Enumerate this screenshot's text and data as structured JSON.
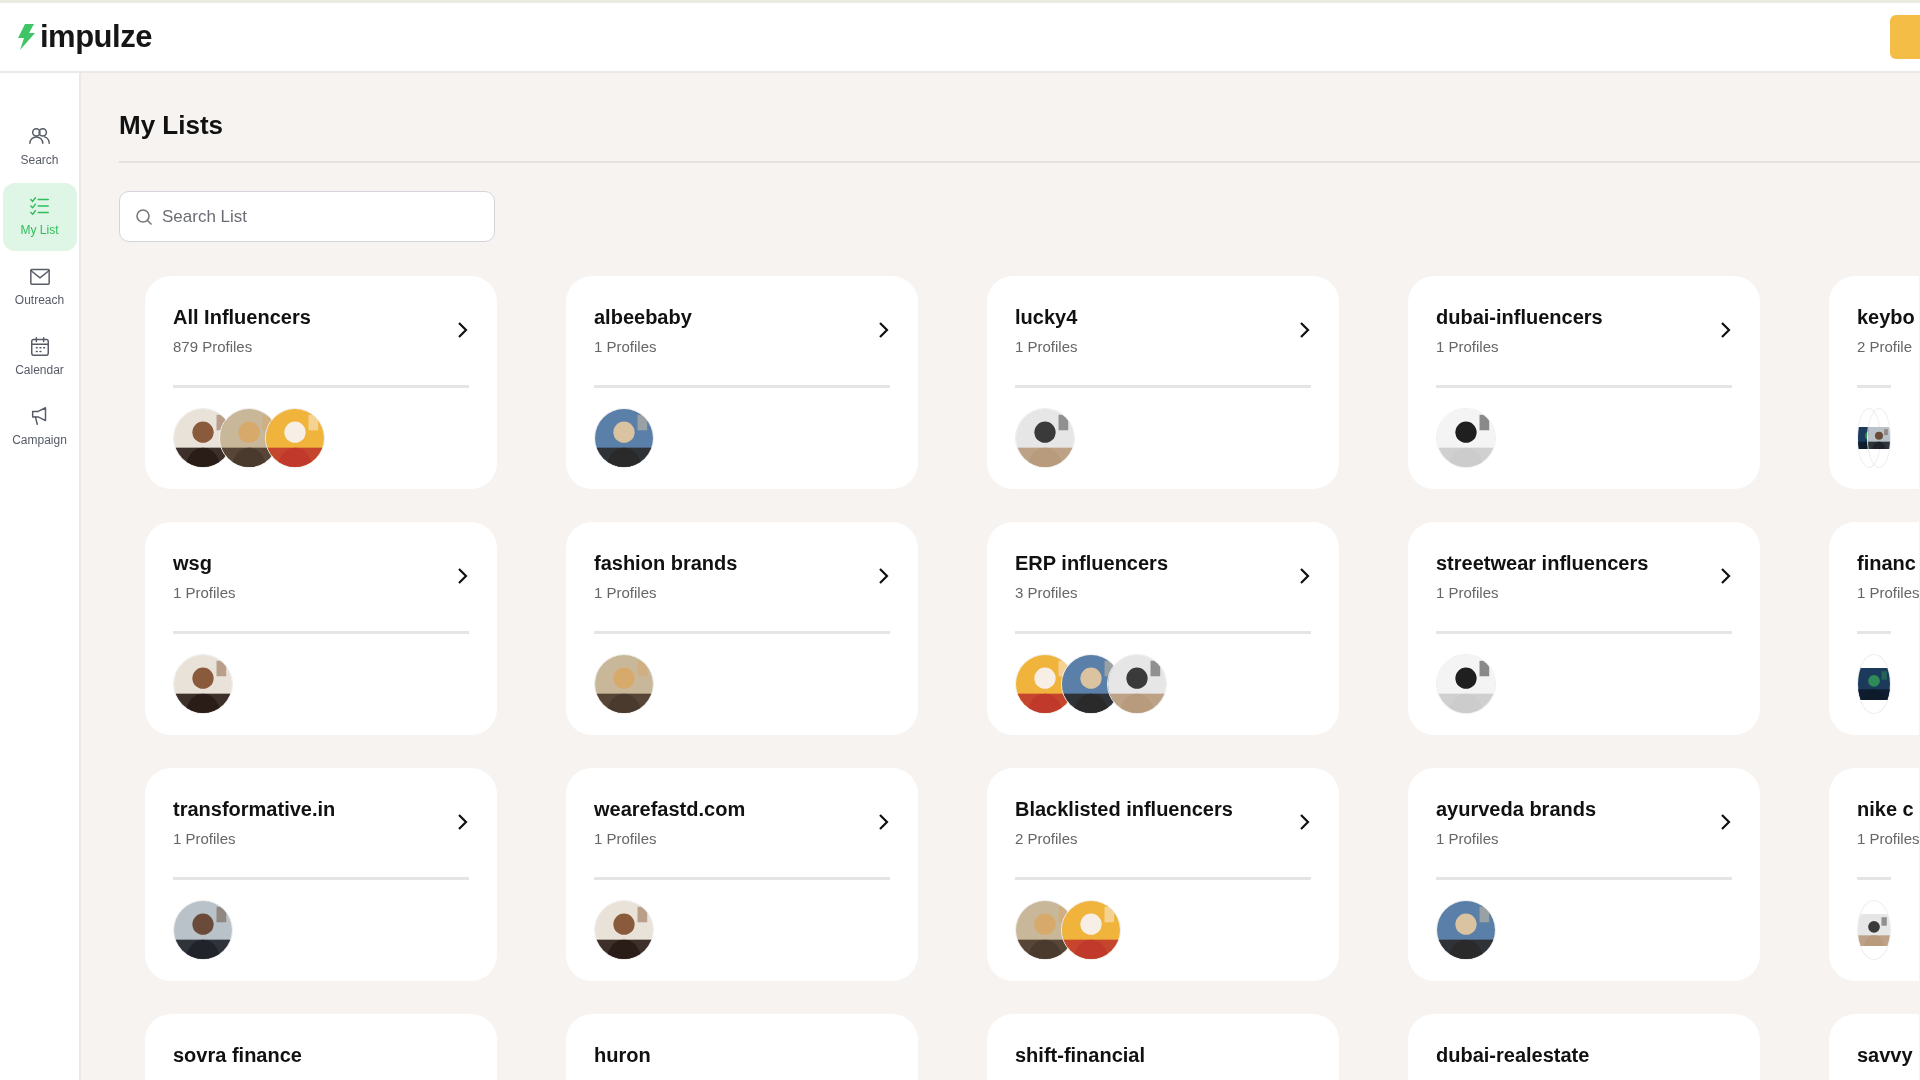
{
  "header": {
    "logo": "impulze"
  },
  "sidebar": {
    "items": [
      {
        "label": "Search",
        "selected": false
      },
      {
        "label": "My List",
        "selected": true
      },
      {
        "label": "Outreach",
        "selected": false
      },
      {
        "label": "Calendar",
        "selected": false
      },
      {
        "label": "Campaign",
        "selected": false
      }
    ]
  },
  "page": {
    "title": "My Lists",
    "search": {
      "placeholder": "Search List"
    }
  },
  "lists": [
    {
      "name": "All Influencers",
      "count": "879 Profiles",
      "chevron": true
    },
    {
      "name": "albeebaby",
      "count": "1 Profiles",
      "chevron": true
    },
    {
      "name": "lucky4",
      "count": "1 Profiles",
      "chevron": true
    },
    {
      "name": "dubai-influencers",
      "count": "1 Profiles",
      "chevron": true
    },
    {
      "name": "keybo",
      "count": "2 Profile",
      "chevron": false
    },
    {
      "name": "wsg",
      "count": "1 Profiles",
      "chevron": true
    },
    {
      "name": "fashion brands",
      "count": "1 Profiles",
      "chevron": true
    },
    {
      "name": "ERP influencers",
      "count": "3 Profiles",
      "chevron": true
    },
    {
      "name": "streetwear influencers",
      "count": "1 Profiles",
      "chevron": true
    },
    {
      "name": "financ",
      "count": "1 Profiles",
      "chevron": false
    },
    {
      "name": "transformative.in",
      "count": "1 Profiles",
      "chevron": true
    },
    {
      "name": "wearefastd.com",
      "count": "1 Profiles",
      "chevron": true
    },
    {
      "name": "Blacklisted influencers",
      "count": "2 Profiles",
      "chevron": true
    },
    {
      "name": "ayurveda brands",
      "count": "1 Profiles",
      "chevron": true
    },
    {
      "name": "nike c",
      "count": "1 Profiles",
      "chevron": false
    },
    {
      "name": "sovra finance",
      "chevron": false
    },
    {
      "name": "huron",
      "chevron": false
    },
    {
      "name": "shift-financial",
      "chevron": false
    },
    {
      "name": "dubai-realestate",
      "chevron": false
    },
    {
      "name": "savvy",
      "chevron": false
    }
  ]
}
